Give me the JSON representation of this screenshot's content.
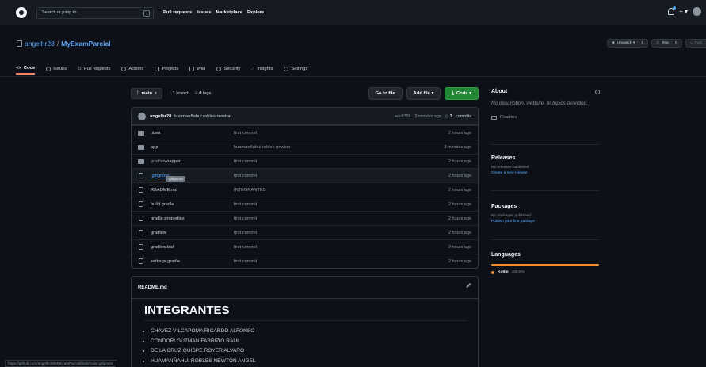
{
  "header": {
    "search_placeholder": "Search or jump to...",
    "slash_key": "/",
    "nav": [
      "Pull requests",
      "Issues",
      "Marketplace",
      "Explore"
    ],
    "right_plus": "+ ▾"
  },
  "repo": {
    "owner": "angelhr28",
    "sep": " / ",
    "name": "MyExamParcial",
    "unwatch_label": "Unwatch ▾",
    "watch_count": "1",
    "star_label": "Star",
    "star_count": "0",
    "fork_label": "Fork",
    "fork_count": "0"
  },
  "tabs": [
    {
      "label": "Code",
      "icon": "code-icon"
    },
    {
      "label": "Issues",
      "icon": "issue-icon"
    },
    {
      "label": "Pull requests",
      "icon": "pull-request-icon"
    },
    {
      "label": "Actions",
      "icon": "play-icon"
    },
    {
      "label": "Projects",
      "icon": "project-icon"
    },
    {
      "label": "Wiki",
      "icon": "book-icon"
    },
    {
      "label": "Security",
      "icon": "shield-icon"
    },
    {
      "label": "Insights",
      "icon": "graph-icon"
    },
    {
      "label": "Settings",
      "icon": "gear-icon"
    }
  ],
  "toolbar": {
    "branch": "main",
    "branches_count": "1",
    "branches_label": " branch",
    "tags_count": "0",
    "tags_label": " tags",
    "go_to_file": "Go to file",
    "add_file": "Add file ▾",
    "code": "Code ▾"
  },
  "commit": {
    "author": "angelhr28",
    "message": "huamanñahui robles newton",
    "hash": "edc8735",
    "time": "3 minutes ago",
    "count": "3",
    "count_label": " commits"
  },
  "files": [
    {
      "name": ".idea",
      "type": "dir",
      "message": "first commit",
      "time": "2 hours ago"
    },
    {
      "name": "app",
      "type": "dir",
      "message": "huamanñahui robles newton",
      "time": "3 minutes ago"
    },
    {
      "name": "gradle/",
      "name2": "wrapper",
      "type": "dir",
      "message": "first commit",
      "time": "2 hours ago"
    },
    {
      "name": ".gitignore",
      "type": "file",
      "message": "first commit",
      "time": "2 hours ago",
      "tooltip": ".gitignore"
    },
    {
      "name": "README.md",
      "type": "file",
      "message": "INTEGRANTES",
      "time": "2 hours ago"
    },
    {
      "name": "build.gradle",
      "type": "file",
      "message": "first commit",
      "time": "2 hours ago"
    },
    {
      "name": "gradle.properties",
      "type": "file",
      "message": "first commit",
      "time": "2 hours ago"
    },
    {
      "name": "gradlew",
      "type": "file",
      "message": "first commit",
      "time": "2 hours ago"
    },
    {
      "name": "gradlew.bat",
      "type": "file",
      "message": "first commit",
      "time": "2 hours ago"
    },
    {
      "name": "settings.gradle",
      "type": "file",
      "message": "first commit",
      "time": "2 hours ago"
    }
  ],
  "readme": {
    "filename": "README.md",
    "title": "INTEGRANTES",
    "members": [
      "CHAVEZ VILCAPOMA RICARDO ALFONSO",
      "CONDORI GUZMAN FABRIZIO RAUL",
      "DE LA CRUZ QUISPE ROYER ALVARO",
      "HUAMANÑAHUI ROBLES NEWTON ANGEL"
    ]
  },
  "sidebar": {
    "about_title": "About",
    "about_desc": "No description, website, or topics provided.",
    "readme_link": "Readme",
    "releases_title": "Releases",
    "releases_none": "No releases published",
    "releases_create": "Create a new release",
    "packages_title": "Packages",
    "packages_none": "No packages published",
    "packages_publish": "Publish your first package",
    "languages_title": "Languages",
    "language_name": "Kotlin",
    "language_percent": "100.0%"
  },
  "status_url": "https://github.com/angelhr28/MyExamParcial/blob/main/.gitignore",
  "colors": {
    "accent_green": "#238636",
    "link": "#58a6ff",
    "kotlin": "#F18E33",
    "tab_underline": "#f78166"
  }
}
